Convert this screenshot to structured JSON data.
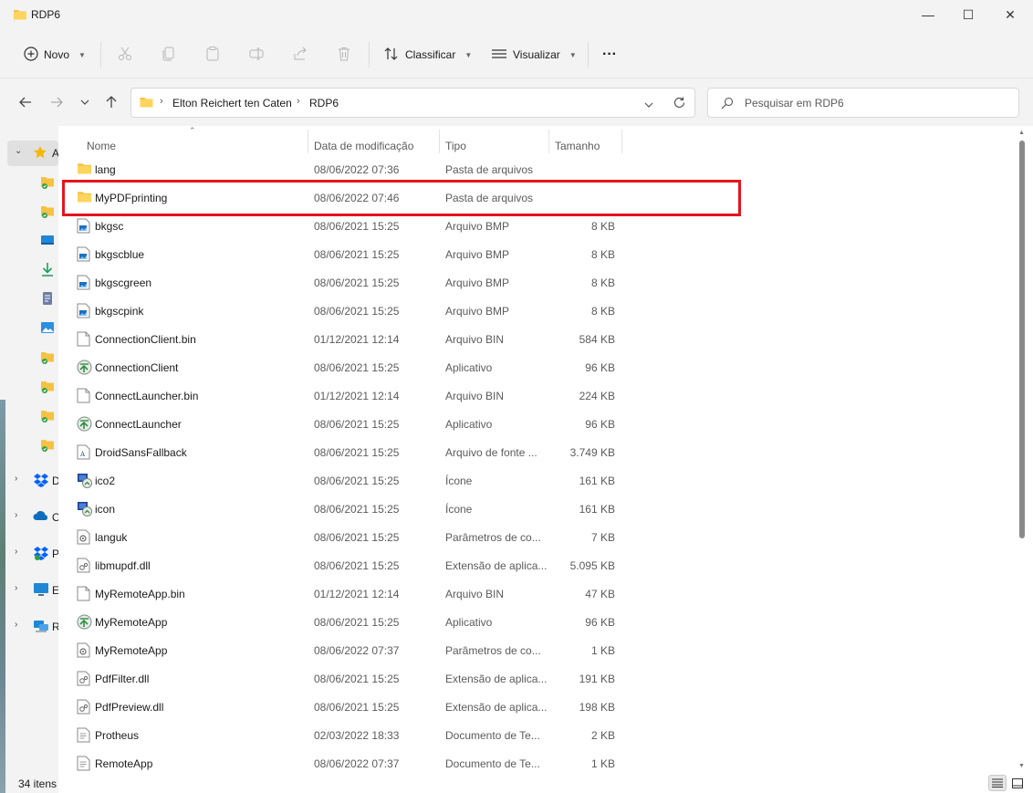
{
  "window": {
    "title": "RDP6",
    "minimize_glyph": "—",
    "maximize_glyph": "☐",
    "close_glyph": "✕"
  },
  "toolbar": {
    "new_label": "Novo",
    "sort_label": "Classificar",
    "view_label": "Visualizar",
    "more_label": "···"
  },
  "address": {
    "crumbs": [
      "Elton Reichert ten Caten",
      "RDP6"
    ],
    "separator": "›"
  },
  "search": {
    "placeholder": "Pesquisar em RDP6"
  },
  "columns": {
    "name": "Nome",
    "date": "Data de modificação",
    "type": "Tipo",
    "size": "Tamanho"
  },
  "navpane": {
    "quick_access_letter": "A",
    "groups": [
      {
        "letter": "D",
        "icon": "dropbox-icon"
      },
      {
        "letter": "O",
        "icon": "onedrive-icon"
      },
      {
        "letter": "P",
        "icon": "dropbox-icon"
      },
      {
        "letter": "E",
        "icon": "this-pc-icon"
      },
      {
        "letter": "R",
        "icon": "network-icon"
      }
    ]
  },
  "files": [
    {
      "name": "lang",
      "date": "08/06/2022 07:36",
      "type": "Pasta de arquivos",
      "size": "",
      "icon": "folder-icon"
    },
    {
      "name": "MyPDFprinting",
      "date": "08/06/2022 07:46",
      "type": "Pasta de arquivos",
      "size": "",
      "icon": "folder-icon"
    },
    {
      "name": "bkgsc",
      "date": "08/06/2021 15:25",
      "type": "Arquivo BMP",
      "size": "8 KB",
      "icon": "bmp-file-icon"
    },
    {
      "name": "bkgscblue",
      "date": "08/06/2021 15:25",
      "type": "Arquivo BMP",
      "size": "8 KB",
      "icon": "bmp-file-icon"
    },
    {
      "name": "bkgscgreen",
      "date": "08/06/2021 15:25",
      "type": "Arquivo BMP",
      "size": "8 KB",
      "icon": "bmp-file-icon"
    },
    {
      "name": "bkgscpink",
      "date": "08/06/2021 15:25",
      "type": "Arquivo BMP",
      "size": "8 KB",
      "icon": "bmp-file-icon"
    },
    {
      "name": "ConnectionClient.bin",
      "date": "01/12/2021 12:14",
      "type": "Arquivo BIN",
      "size": "584 KB",
      "icon": "blank-file-icon"
    },
    {
      "name": "ConnectionClient",
      "date": "08/06/2021 15:25",
      "type": "Aplicativo",
      "size": "96 KB",
      "icon": "remote-app-icon"
    },
    {
      "name": "ConnectLauncher.bin",
      "date": "01/12/2021 12:14",
      "type": "Arquivo BIN",
      "size": "224 KB",
      "icon": "blank-file-icon"
    },
    {
      "name": "ConnectLauncher",
      "date": "08/06/2021 15:25",
      "type": "Aplicativo",
      "size": "96 KB",
      "icon": "remote-app-icon"
    },
    {
      "name": "DroidSansFallback",
      "date": "08/06/2021 15:25",
      "type": "Arquivo de fonte ...",
      "size": "3.749 KB",
      "icon": "font-file-icon"
    },
    {
      "name": "ico2",
      "date": "08/06/2021 15:25",
      "type": "Ícone",
      "size": "161 KB",
      "icon": "ico-file-icon"
    },
    {
      "name": "icon",
      "date": "08/06/2021 15:25",
      "type": "Ícone",
      "size": "161 KB",
      "icon": "ico-file-icon"
    },
    {
      "name": "languk",
      "date": "08/06/2021 15:25",
      "type": "Parâmetros de co...",
      "size": "7 KB",
      "icon": "config-file-icon"
    },
    {
      "name": "libmupdf.dll",
      "date": "08/06/2021 15:25",
      "type": "Extensão de aplica...",
      "size": "5.095 KB",
      "icon": "dll-file-icon"
    },
    {
      "name": "MyRemoteApp.bin",
      "date": "01/12/2021 12:14",
      "type": "Arquivo BIN",
      "size": "47 KB",
      "icon": "blank-file-icon"
    },
    {
      "name": "MyRemoteApp",
      "date": "08/06/2021 15:25",
      "type": "Aplicativo",
      "size": "96 KB",
      "icon": "remote-app-icon"
    },
    {
      "name": "MyRemoteApp",
      "date": "08/06/2022 07:37",
      "type": "Parâmetros de co...",
      "size": "1 KB",
      "icon": "config-file-icon"
    },
    {
      "name": "PdfFilter.dll",
      "date": "08/06/2021 15:25",
      "type": "Extensão de aplica...",
      "size": "191 KB",
      "icon": "dll-file-icon"
    },
    {
      "name": "PdfPreview.dll",
      "date": "08/06/2021 15:25",
      "type": "Extensão de aplica...",
      "size": "198 KB",
      "icon": "dll-file-icon"
    },
    {
      "name": "Protheus",
      "date": "02/03/2022 18:33",
      "type": "Documento de Te...",
      "size": "2 KB",
      "icon": "text-file-icon"
    },
    {
      "name": "RemoteApp",
      "date": "08/06/2022 07:37",
      "type": "Documento de Te...",
      "size": "1 KB",
      "icon": "text-file-icon"
    }
  ],
  "status": {
    "count": "34 itens"
  },
  "colors": {
    "highlight": "#e3151d",
    "folder": "#f5c242",
    "chrome": "#f3f3f3"
  }
}
